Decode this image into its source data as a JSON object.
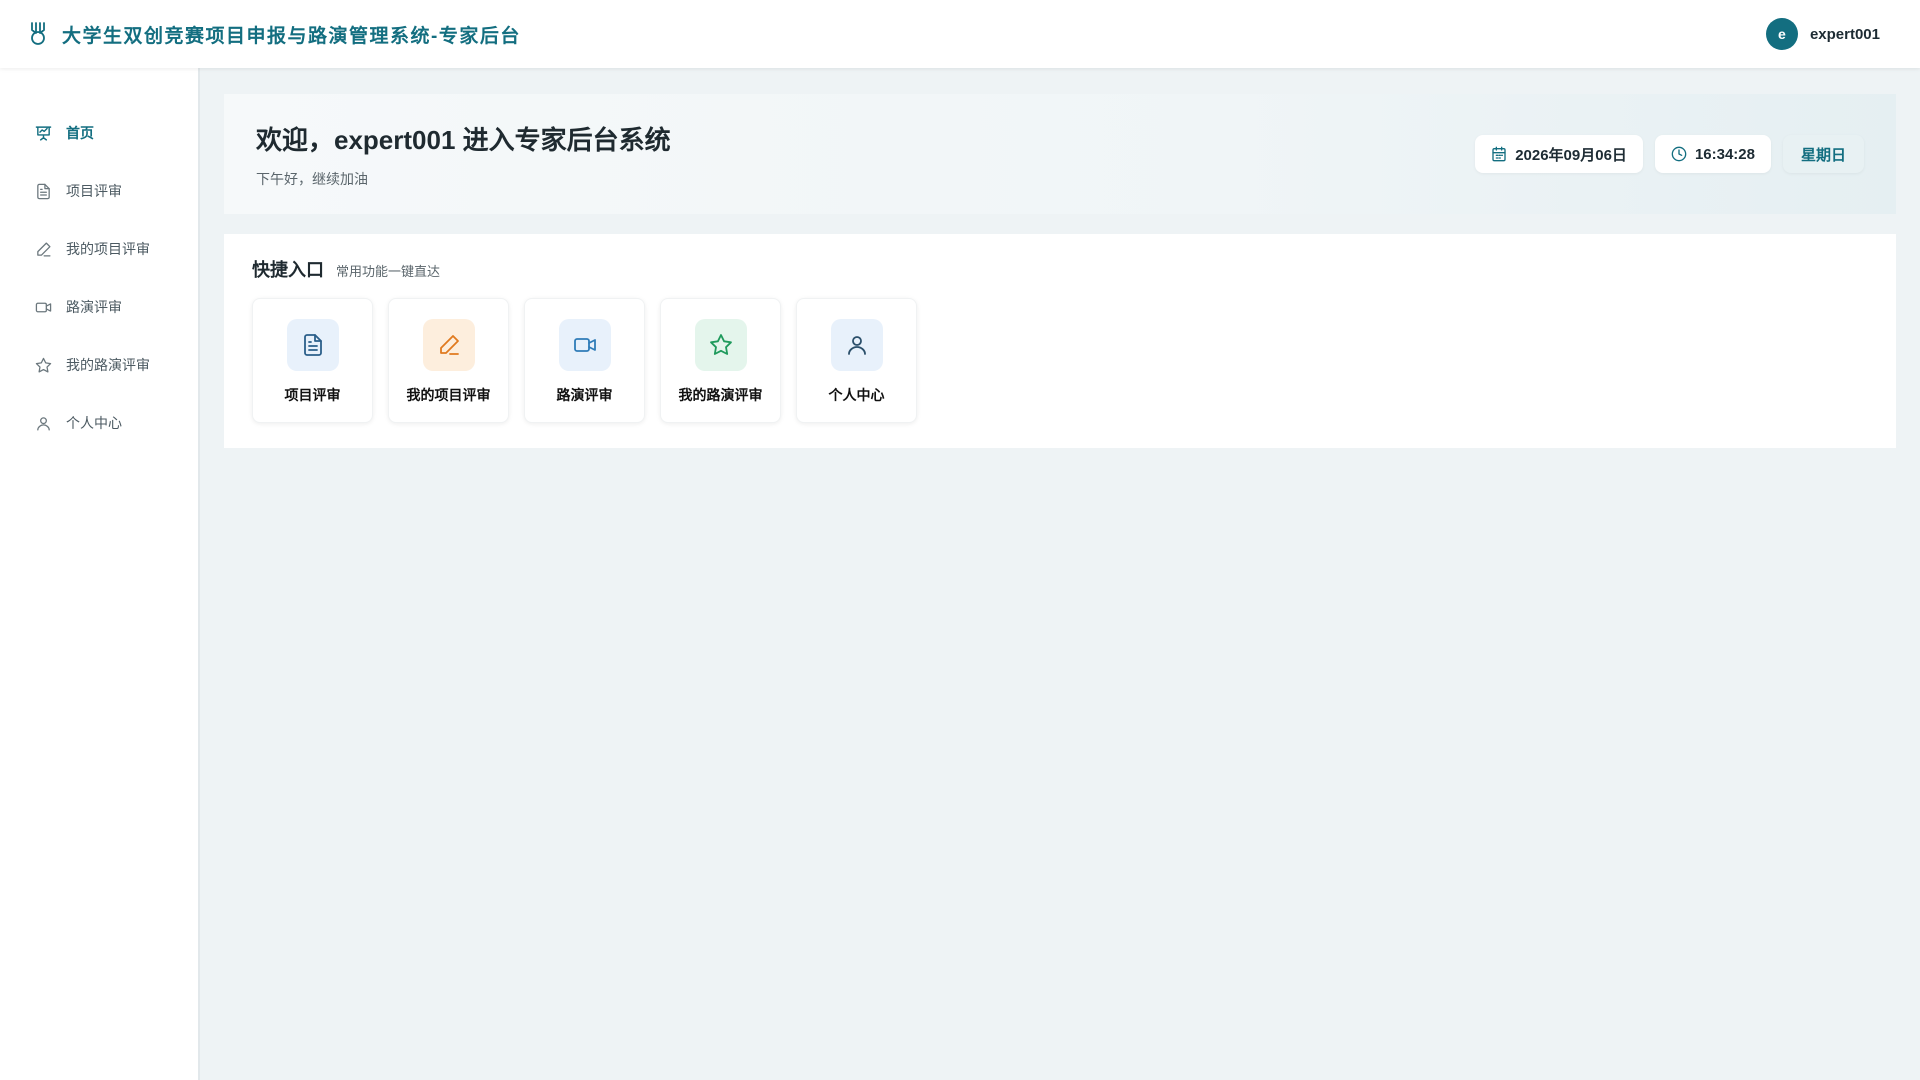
{
  "header": {
    "title": "大学生双创竞赛项目申报与路演管理系统-专家后台",
    "logo_icon": "medal-icon",
    "avatar_letter": "e",
    "username": "expert001"
  },
  "sidebar": {
    "items": [
      {
        "label": "首页",
        "icon": "presentation-chart-icon",
        "active": true
      },
      {
        "label": "项目评审",
        "icon": "document-icon"
      },
      {
        "label": "我的项目评审",
        "icon": "pen-icon"
      },
      {
        "label": "路演评审",
        "icon": "video-camera-icon"
      },
      {
        "label": "我的路演评审",
        "icon": "star-icon"
      },
      {
        "label": "个人中心",
        "icon": "user-icon"
      }
    ]
  },
  "welcome": {
    "title": "欢迎，expert001 进入专家后台系统",
    "subtitle": "下午好，继续加油",
    "date": "2026年09月06日",
    "time": "16:34:28",
    "weekday": "星期日"
  },
  "quick": {
    "title": "快捷入口",
    "subtitle": "常用功能一键直达",
    "cards": [
      {
        "label": "项目评审",
        "icon": "document-icon",
        "bg": "#e8f1fb",
        "color": "#2b5f8a"
      },
      {
        "label": "我的项目评审",
        "icon": "pen-icon",
        "bg": "#fdeedd",
        "color": "#e07a1f"
      },
      {
        "label": "路演评审",
        "icon": "video-camera-icon",
        "bg": "#e8f1fb",
        "color": "#2f7cb8"
      },
      {
        "label": "我的路演评审",
        "icon": "star-icon",
        "bg": "#e4f5ec",
        "color": "#1f9a5c"
      },
      {
        "label": "个人中心",
        "icon": "user-icon",
        "bg": "#e8f1fb",
        "color": "#2b4f6a"
      }
    ]
  },
  "colors": {
    "brand": "#136e80",
    "background": "#eef3f5"
  }
}
